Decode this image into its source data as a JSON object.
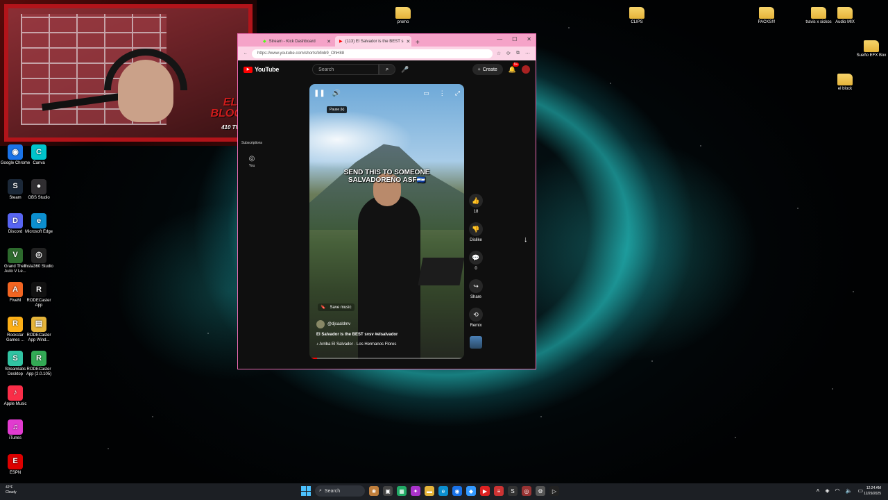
{
  "overlay": {
    "logo_text": "EL BLOCK",
    "logo_sub": "410 TV"
  },
  "desktop_icons": {
    "top": [
      {
        "label": "promo",
        "type": "folder"
      },
      {
        "label": "CLIPS",
        "type": "folder"
      },
      {
        "label": "PACKS!!!",
        "type": "folder"
      },
      {
        "label": "travis x sickos",
        "type": "folder"
      },
      {
        "label": "Audio MIX",
        "type": "folder"
      },
      {
        "label": "Sueño EFX Box",
        "type": "folder"
      },
      {
        "label": "el block",
        "type": "folder"
      }
    ],
    "left": [
      {
        "label": "Google Chrome",
        "color": "#1a73e8",
        "glyph": "◉"
      },
      {
        "label": "Canva",
        "color": "#00c4cc",
        "glyph": "C"
      },
      {
        "label": "Steam",
        "color": "#1b2838",
        "glyph": "S"
      },
      {
        "label": "OBS Studio",
        "color": "#302e31",
        "glyph": "●"
      },
      {
        "label": "Discord",
        "color": "#5865f2",
        "glyph": "D"
      },
      {
        "label": "Microsoft Edge",
        "color": "#0c8fcf",
        "glyph": "e"
      },
      {
        "label": "Grand Theft Auto V Le...",
        "color": "#2d6a2d",
        "glyph": "V"
      },
      {
        "label": "Insta360 Studio",
        "color": "#222",
        "glyph": "◎"
      },
      {
        "label": "FiveM",
        "color": "#f26522",
        "glyph": "A"
      },
      {
        "label": "RODECaster App",
        "color": "#111",
        "glyph": "R"
      },
      {
        "label": "Rockstar Games ...",
        "color": "#fcaf17",
        "glyph": "R"
      },
      {
        "label": "RODECaster App Wind...",
        "color": "#e5b43a",
        "glyph": "▤"
      },
      {
        "label": "Streamlabs Desktop",
        "color": "#31c3a2",
        "glyph": "S"
      },
      {
        "label": "RODECaster App (2.0.105)",
        "color": "#3a5",
        "glyph": "R"
      },
      {
        "label": "Apple Music",
        "color": "#fa2d48",
        "glyph": "♪"
      },
      {
        "label": "iTunes",
        "color": "#e23bd0",
        "glyph": "♫"
      },
      {
        "label": "ESPN",
        "color": "#d00",
        "glyph": "E"
      }
    ]
  },
  "browser": {
    "tabs": [
      {
        "label": "Stream - Kick Dashboard"
      },
      {
        "label": "(113) El Salvador is the BEST s"
      }
    ],
    "url": "https://www.youtube.com/shorts/Minb9_OhH88",
    "yt": {
      "brand": "YouTube",
      "search_placeholder": "Search",
      "create_label": "Create",
      "notif_count": "9+",
      "side_items": [
        {
          "label": "Subscriptions"
        },
        {
          "label": "You"
        }
      ]
    },
    "video": {
      "caption_line1": "SEND THIS TO SOMEONE",
      "caption_line2": "SALVADOREÑO ASF🇸🇻",
      "tooltip": "Pause (k)",
      "save_music": "Save music",
      "channel": "@djsaaldmv",
      "title": "El Salvador is the BEST svsv #elsalvador",
      "music": "Arriba El Salvador · Los Hermanos Flores",
      "progress": 0.05
    },
    "actions": {
      "like_count": "18",
      "dislike_label": "Dislike",
      "comment_count": "0",
      "share_label": "Share",
      "remix_label": "Remix"
    }
  },
  "taskbar": {
    "weather_temp": "42°F",
    "weather_desc": "Cloudy",
    "search_label": "Search",
    "time": "12:24 AM",
    "date": "12/29/2025"
  }
}
